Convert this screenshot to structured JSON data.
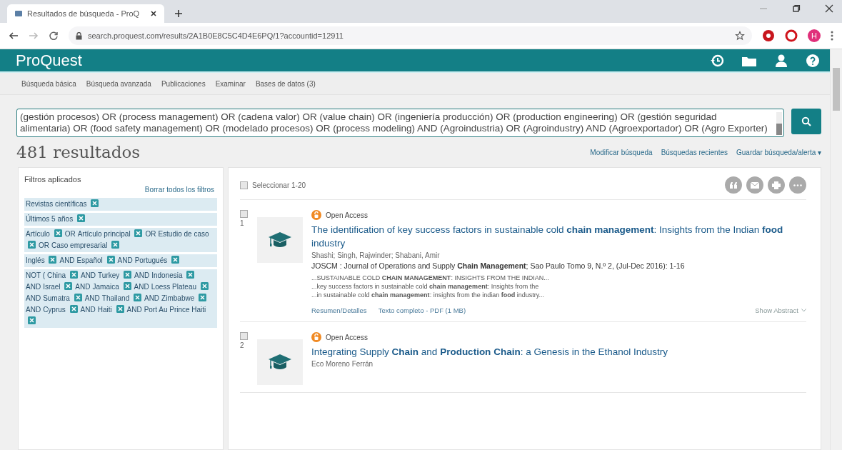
{
  "browser": {
    "tab_title": "Resultados de búsqueda - ProQ",
    "url": "search.proquest.com/results/2A1B0E8C5C4D4E6PQ/1?accountid=12911",
    "profile_initial": "H"
  },
  "header": {
    "logo": "ProQuest"
  },
  "nav": [
    "Búsqueda básica",
    "Búsqueda avanzada",
    "Publicaciones",
    "Examinar",
    "Bases de datos (3)"
  ],
  "search": {
    "value": "(gestión procesos) OR (process management) OR (cadena valor) OR (value chain) OR (ingeniería producción) OR (production engineering) OR (gestión seguridad alimentaria) OR (food safety management) OR (modelado procesos) OR (process modeling) AND (Agroindustria) OR (Agroindustry) AND (Agroexportador) OR (Agro Exporter)"
  },
  "results_count": "481 resultados",
  "actions": [
    "Modificar búsqueda",
    "Búsquedas recientes",
    "Guardar búsqueda/alerta ▾"
  ],
  "filters": {
    "title": "Filtros aplicados",
    "clear_all": "Borrar todos los filtros",
    "groups": [
      [
        {
          "kind": "term",
          "text": "Revistas científicas"
        }
      ],
      [
        {
          "kind": "term",
          "text": "Últimos 5 años"
        }
      ],
      [
        {
          "kind": "term",
          "text": "Artículo"
        },
        {
          "kind": "op",
          "text": "OR"
        },
        {
          "kind": "term",
          "text": "Artículo principal"
        },
        {
          "kind": "op",
          "text": "OR"
        },
        {
          "kind": "term",
          "text": "Estudio de caso"
        },
        {
          "kind": "op",
          "text": "OR"
        },
        {
          "kind": "term",
          "text": "Caso empresarial"
        }
      ],
      [
        {
          "kind": "term",
          "text": "Inglés"
        },
        {
          "kind": "op",
          "text": "AND"
        },
        {
          "kind": "term",
          "text": "Español"
        },
        {
          "kind": "op",
          "text": "AND"
        },
        {
          "kind": "term",
          "text": "Portugués"
        }
      ],
      [
        {
          "kind": "op",
          "text": "NOT ("
        },
        {
          "kind": "term",
          "text": "China"
        },
        {
          "kind": "op",
          "text": "AND"
        },
        {
          "kind": "term",
          "text": "Turkey"
        },
        {
          "kind": "op",
          "text": "AND"
        },
        {
          "kind": "term",
          "text": "Indonesia"
        },
        {
          "kind": "op",
          "text": "AND"
        },
        {
          "kind": "term",
          "text": "Israel"
        },
        {
          "kind": "op",
          "text": "AND"
        },
        {
          "kind": "term",
          "text": "Jamaica"
        },
        {
          "kind": "op",
          "text": "AND"
        },
        {
          "kind": "term",
          "text": "Loess Plateau"
        },
        {
          "kind": "op",
          "text": "AND"
        },
        {
          "kind": "term",
          "text": "Sumatra"
        },
        {
          "kind": "op",
          "text": "AND"
        },
        {
          "kind": "term",
          "text": "Thailand"
        },
        {
          "kind": "op",
          "text": "AND"
        },
        {
          "kind": "term",
          "text": "Zimbabwe"
        },
        {
          "kind": "op",
          "text": "AND"
        },
        {
          "kind": "term",
          "text": "Cyprus"
        },
        {
          "kind": "op",
          "text": "AND"
        },
        {
          "kind": "term",
          "text": "Haiti"
        },
        {
          "kind": "op",
          "text": "AND"
        },
        {
          "kind": "term",
          "text": "Port Au Prince Haiti"
        }
      ]
    ]
  },
  "results": {
    "select_all": {
      "label": "Seleccionar 1-20",
      "checked": false
    },
    "items": [
      {
        "number": "1",
        "checked": false,
        "access": "Open Access",
        "title": "The identification of key success factors in sustainable cold **chain** **management**: Insights from the Indian **food** industry",
        "authors": "Shashi; Singh, Rajwinder; Shabani, Amir",
        "source": "JOSCM : Journal of Operations and Supply **Chain** **Management**; Sao Paulo Tomo 9, N.º 2,  (Jul-Dec 2016): 1-16",
        "snippets": [
          "...SUSTAINABLE COLD **CHAIN** **MANAGEMENT**: INSIGHTS FROM THE INDIAN...",
          "...key success factors in sustainable cold **chain** **management**: Insights from the",
          "...in sustainable cold **chain** **management**: insights from the indian **food** industry..."
        ],
        "links": [
          "Resumen/Detalles",
          "Texto completo - PDF (1 MB)"
        ],
        "show_abstract": "Show Abstract"
      },
      {
        "number": "2",
        "checked": false,
        "access": "Open Access",
        "title": "Integrating Supply **Chain** and **Production** **Chain**: a Genesis in the Ethanol Industry",
        "authors": "Eco Moreno Ferrán"
      }
    ]
  }
}
